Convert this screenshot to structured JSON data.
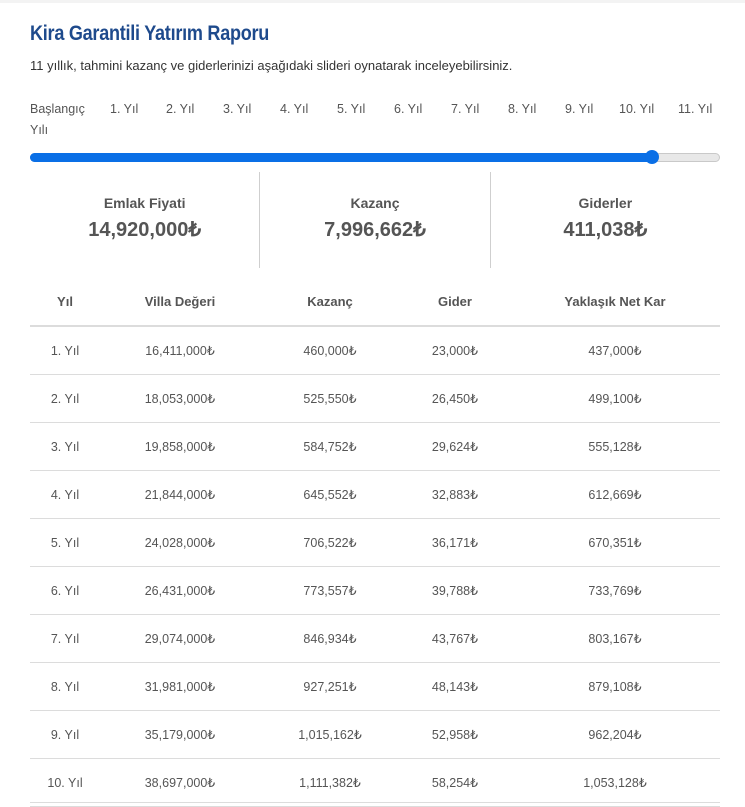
{
  "report": {
    "title": "Kira Garantili Yatırım Raporu",
    "subtitle": "11 yıllık, tahmini kazanç ve giderlerinizi aşağıdaki slideri oynatarak inceleyebilirsiniz."
  },
  "slider": {
    "ticks": [
      "Başlangıç Yılı",
      "1. Yıl",
      "2. Yıl",
      "3. Yıl",
      "4. Yıl",
      "5. Yıl",
      "6. Yıl",
      "7. Yıl",
      "8. Yıl",
      "9. Yıl",
      "10. Yıl",
      "11. Yıl"
    ],
    "value_fraction": 0.901,
    "accent_color": "#0a6fe6"
  },
  "summary": [
    {
      "label": "Emlak Fiyati",
      "value": "14,920,000₺"
    },
    {
      "label": "Kazanç",
      "value": "7,996,662₺"
    },
    {
      "label": "Giderler",
      "value": "411,038₺"
    }
  ],
  "table": {
    "headers": [
      "Yıl",
      "Villa Değeri",
      "Kazanç",
      "Gider",
      "Yaklaşık Net Kar"
    ],
    "rows": [
      [
        "1. Yıl",
        "16,411,000₺",
        "460,000₺",
        "23,000₺",
        "437,000₺"
      ],
      [
        "2. Yıl",
        "18,053,000₺",
        "525,550₺",
        "26,450₺",
        "499,100₺"
      ],
      [
        "3. Yıl",
        "19,858,000₺",
        "584,752₺",
        "29,624₺",
        "555,128₺"
      ],
      [
        "4. Yıl",
        "21,844,000₺",
        "645,552₺",
        "32,883₺",
        "612,669₺"
      ],
      [
        "5. Yıl",
        "24,028,000₺",
        "706,522₺",
        "36,171₺",
        "670,351₺"
      ],
      [
        "6. Yıl",
        "26,431,000₺",
        "773,557₺",
        "39,788₺",
        "733,769₺"
      ],
      [
        "7. Yıl",
        "29,074,000₺",
        "846,934₺",
        "43,767₺",
        "803,167₺"
      ],
      [
        "8. Yıl",
        "31,981,000₺",
        "927,251₺",
        "48,143₺",
        "879,108₺"
      ],
      [
        "9. Yıl",
        "35,179,000₺",
        "1,015,162₺",
        "52,958₺",
        "962,204₺"
      ],
      [
        "10. Yıl",
        "38,697,000₺",
        "1,111,382₺",
        "58,254₺",
        "1,053,128₺"
      ]
    ]
  }
}
